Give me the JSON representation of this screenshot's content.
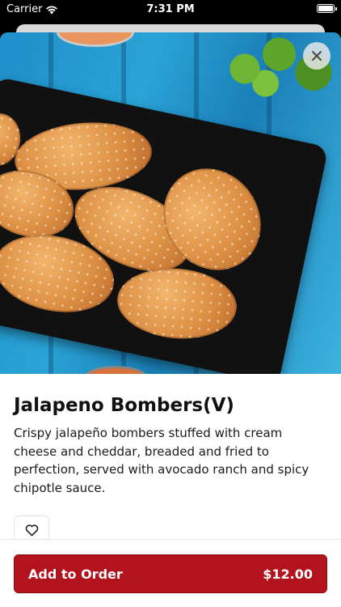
{
  "status_bar": {
    "carrier": "Carrier",
    "time": "7:31 PM",
    "icons": [
      "wifi-icon",
      "battery-icon"
    ]
  },
  "item": {
    "name": "Jalapeno Bombers(V)",
    "description": "Crispy jalapeño bombers stuffed with cream cheese and cheddar, breaded and fried to perfection, served with avocado ranch and spicy chipotle sauce.",
    "image": "photo of breaded fried jalapeño poppers on a black tray on a blue wooden table"
  },
  "actions": {
    "close_icon": "close-icon",
    "favorite_icon": "heart-icon",
    "add_to_order_label": "Add to Order",
    "price": "$12.00"
  },
  "colors": {
    "accent": "#b3131c",
    "text": "#111111",
    "background": "#ffffff"
  }
}
